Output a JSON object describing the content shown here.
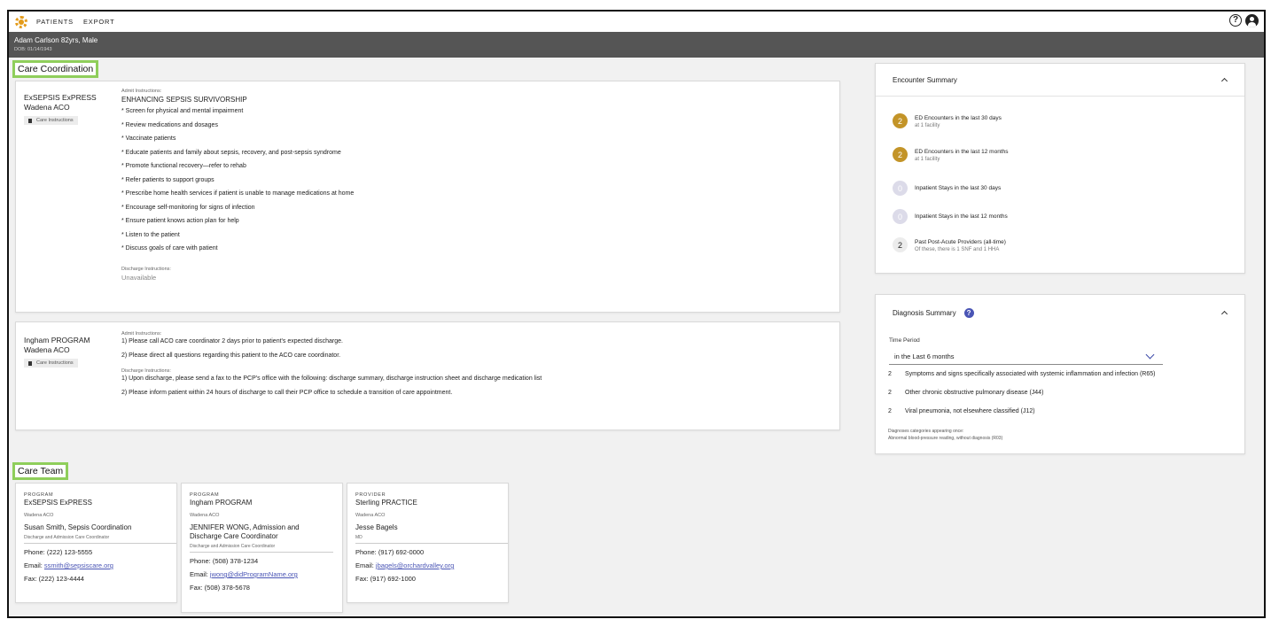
{
  "nav": {
    "items": [
      "PATIENTS",
      "EXPORT"
    ]
  },
  "patient": {
    "name_line": "Adam Carlson 82yrs, Male",
    "dob": "DOB: 01/14/1943"
  },
  "care_coordination": {
    "title": "Care Coordination",
    "programs": [
      {
        "name": "ExSEPSIS ExPRESS",
        "org": "Wadena ACO",
        "chip": "Care Instructions",
        "admit_label": "Admit Instructions:",
        "admit_title": "ENHANCING SEPSIS SURVIVORSHIP",
        "admit_lines": [
          "* Screen for physical and mental impairment",
          "* Review medications and dosages",
          "* Vaccinate patients",
          "* Educate patients and family about sepsis, recovery, and post-sepsis syndrome",
          "* Promote functional recovery—refer to rehab",
          "* Refer patients to support groups",
          "* Prescribe home health services if patient is unable to manage medications at home",
          "* Encourage self-monitoring for signs of infection",
          "* Ensure patient knows action plan for help",
          "* Listen to the patient",
          "* Discuss goals of care with patient"
        ],
        "discharge_label": "Discharge Instructions:",
        "discharge_value": "Unavailable"
      },
      {
        "name": "Ingham PROGRAM",
        "org": "Wadena ACO",
        "chip": "Care Instructions",
        "admit_label": "Admit Instructions:",
        "admit_lines": [
          "1) Please call ACO care coordinator 2 days prior to patient's expected discharge.",
          "2) Please direct all questions regarding this patient to the ACO care coordinator."
        ],
        "discharge_label": "Discharge Instructions:",
        "discharge_lines": [
          "1) Upon discharge, please send a fax to the PCP's office with the following: discharge summary, discharge instruction sheet and discharge medication list",
          "2) Please inform patient within 24 hours of discharge to call their PCP office to schedule a transition of care appointment."
        ]
      }
    ]
  },
  "encounter_summary": {
    "title": "Encounter Summary",
    "items": [
      {
        "count": "2",
        "label": "ED Encounters in the last 30 days",
        "sub": "at 1 facility"
      },
      {
        "count": "2",
        "label": "ED Encounters in the last 12 months",
        "sub": "at 1 facility"
      },
      {
        "count": "0",
        "label": "Inpatient Stays in the last 30 days",
        "sub": ""
      },
      {
        "count": "0",
        "label": "Inpatient Stays in the last 12 months",
        "sub": ""
      },
      {
        "count": "2",
        "label": "Past Post-Acute Providers (all-time)",
        "sub": "Of these, there is 1 SNF and 1 HHA"
      }
    ]
  },
  "diagnosis_summary": {
    "title": "Diagnosis Summary",
    "time_period_label": "Time Period",
    "time_period_value": "in the Last 6 months",
    "items": [
      {
        "count": "2",
        "label": "Symptoms and signs specifically associated with systemic inflammation and infection (R65)"
      },
      {
        "count": "2",
        "label": "Other chronic obstructive pulmonary disease (J44)"
      },
      {
        "count": "2",
        "label": "Viral pneumonia, not elsewhere classified (J12)"
      }
    ],
    "once_label": "Diagnoses categories appearing once:",
    "once_value": "Abnormal blood-pressure reading, without diagnosis (R03)"
  },
  "care_team": {
    "title": "Care Team",
    "cards": [
      {
        "role": "PROGRAM",
        "name": "ExSEPSIS ExPRESS",
        "org": "Wadena ACO",
        "member": "Susan Smith, Sepsis Coordination",
        "member_title": "Discharge and Admission Care Coordinator",
        "phone": "Phone: (222) 123-5555",
        "email_label": "Email: ",
        "email": "ssmith@sepsiscare.org",
        "fax": "Fax: (222) 123-4444"
      },
      {
        "role": "PROGRAM",
        "name": "Ingham PROGRAM",
        "org": "Wadena ACO",
        "member": "JENNIFER WONG, Admission and Discharge Care Coordinator",
        "member_title": "Discharge and Admission Care Coordinator",
        "phone": "Phone: (508) 378-1234",
        "email_label": "Email: ",
        "email": "jwong@didProgramName.org",
        "fax": "Fax: (508) 378-5678"
      },
      {
        "role": "PROVIDER",
        "name": "Sterling PRACTICE",
        "org": "Wadena ACO",
        "member": "Jesse Bagels",
        "member_title": "MD",
        "phone": "Phone: (917) 692-0000",
        "email_label": "Email: ",
        "email": "jbagels@orchardvalley.org",
        "fax": "Fax: (917) 692-1000"
      }
    ]
  },
  "icons": {
    "logo": "sun-logo-icon",
    "help": "help-circle-icon",
    "account": "account-circle-icon",
    "clipboard": "clipboard-icon",
    "info": "question-circle-icon",
    "collapse": "chevron-up-icon",
    "dropdown": "chevron-down-icon"
  },
  "colors": {
    "section_highlight": "#8fce5b",
    "badge_gold": "#c39428",
    "badge_zero": "#dcdbe9",
    "accent_blue": "#4a55b5",
    "patient_bar": "#555555"
  }
}
